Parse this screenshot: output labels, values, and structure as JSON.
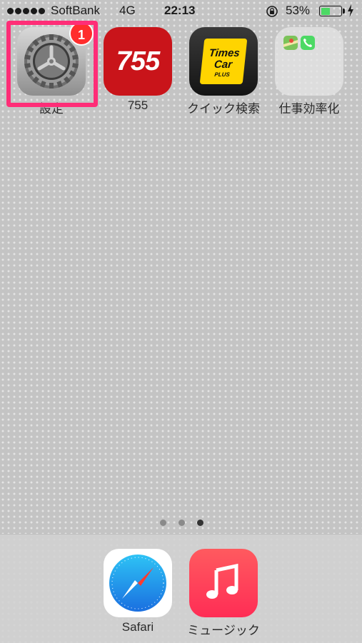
{
  "status_bar": {
    "carrier": "SoftBank",
    "network": "4G",
    "time": "22:13",
    "battery_percent": "53%",
    "battery_level": 0.53
  },
  "home": {
    "apps": [
      {
        "label": "設定",
        "badge": "1",
        "icon": "settings-gear-icon"
      },
      {
        "label": "755",
        "icon_text": "755",
        "icon": "755-app-icon"
      },
      {
        "label": "クイック検索",
        "icon_text_1": "Times",
        "icon_text_2": "Car",
        "icon_text_3": "PLUS",
        "icon": "times-car-plus-icon"
      },
      {
        "label": "仕事効率化",
        "icon": "folder-icon"
      }
    ],
    "page_count": 3,
    "current_page": 3
  },
  "dock": {
    "apps": [
      {
        "label": "Safari",
        "icon": "safari-compass-icon"
      },
      {
        "label": "ミュージック",
        "icon": "music-note-icon"
      }
    ]
  },
  "colors": {
    "highlight": "#ff2d77",
    "badge": "#ff2d2d",
    "battery": "#4cd964"
  }
}
